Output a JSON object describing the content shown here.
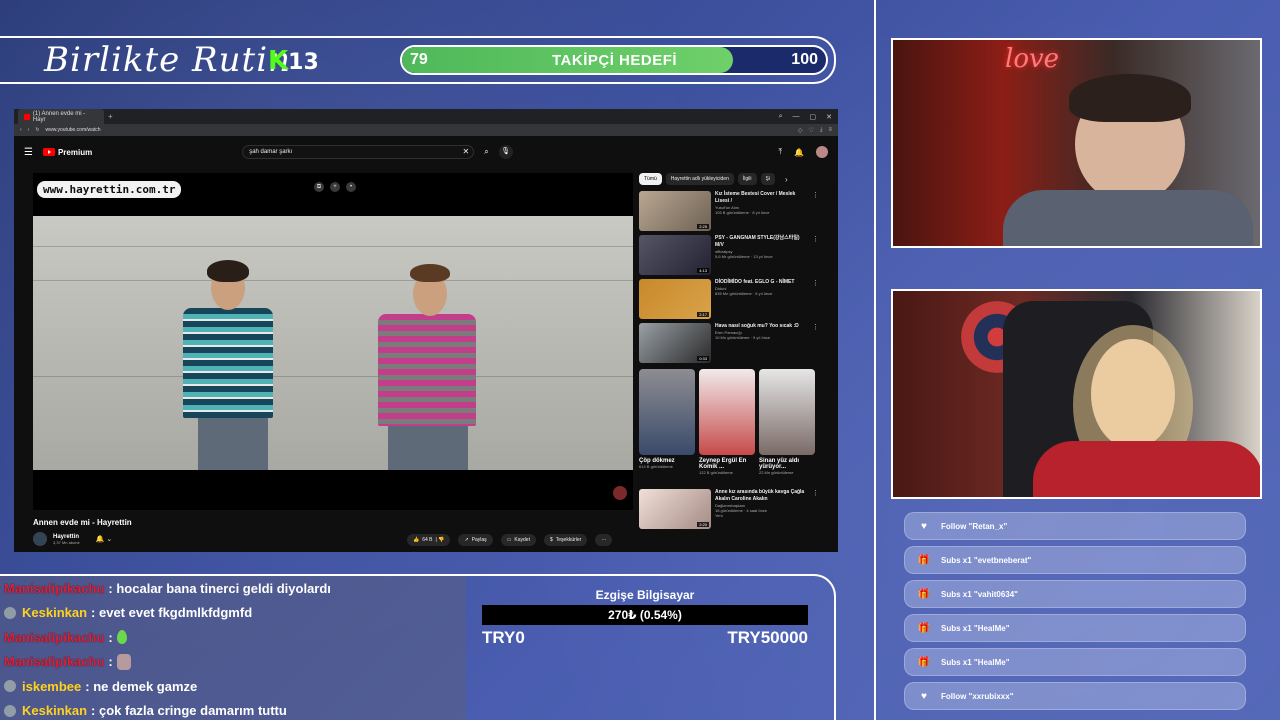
{
  "brand": {
    "title": "Birlikte Rutin",
    "k_letter": "K",
    "k_num": "13"
  },
  "goal": {
    "start": "79",
    "title": "TAKİPÇİ HEDEFİ",
    "end": "100",
    "progress_percent": 79
  },
  "browser": {
    "tab_title": "(1) Annen evde mi - Hayr",
    "url": "www.youtube.com/watch",
    "logo_text": "Premium",
    "search_query": "şah damar şarkı",
    "video_watermark": "www.hayrettin.com.tr",
    "video_title": "Annen evde mi - Hayrettin",
    "channel_name": "Hayrettin",
    "channel_subs": "3,37 Mn abone",
    "actions": {
      "like": "64 B",
      "share": "Paylaş",
      "save": "Kaydet",
      "thanks": "Teşekkürler",
      "more": "···"
    },
    "chips": [
      "Tümü",
      "Hayrettin adlı yükleyiciden",
      "İlgili",
      "Şi"
    ],
    "recommendations": [
      {
        "title": "Kız İsteme Bestesi Cover / Meslek Lisesi /",
        "channel": "Yusuf'un Alını",
        "meta": "105 B görüntüleme · 8 yıl önce",
        "duration": "2:25"
      },
      {
        "title": "PSY - GANGNAM STYLE(강남스타일) M/V",
        "channel": "officialpsy",
        "meta": "5,6 Mr görüntüleme · 13 yıl önce",
        "duration": "4:13"
      },
      {
        "title": "DİODİMİDO feat. EGLO G - NİMET",
        "channel": "Diduni",
        "meta": "835 Mn görüntüleme · 5 yıl önce",
        "duration": "2:17"
      },
      {
        "title": "Hava nasıl soğuk mu? Yoo sıcak :D",
        "channel": "Eren Parnacığı",
        "meta": "10 Mn görüntüleme · 9 yıl önce",
        "duration": "0:33"
      }
    ],
    "shorts": [
      {
        "title": "Çöp dökmez",
        "meta": "614 B görüntüleme"
      },
      {
        "title": "Zeynep Ergül En Komik ...",
        "meta": "122 B görüntüleme"
      },
      {
        "title": "Sinan yüz aldı yürüyor...",
        "meta": "22 Mn görüntüleme"
      }
    ],
    "last_rec": {
      "title": "Anne kız arasında büyük kavga Çağla Akalın Caroline Akalın",
      "channel": "Dağlarımbaşkanı",
      "meta": "18 görüntüleme · 4 saat önce",
      "badge": "Yeni",
      "duration": "2:20"
    }
  },
  "chat": [
    {
      "user": "Manisalipikachu",
      "text": ": hocalar bana tinerci geldi diyolardı",
      "color": "red"
    },
    {
      "user": "Keskinkan",
      "text": ": evet evet fkgdmlkfdgmfd",
      "color": "yellow"
    },
    {
      "user": "Manisalipikachu",
      "text": ":",
      "color": "red",
      "emoji": "drop"
    },
    {
      "user": "Manisalipikachu",
      "text": ":",
      "color": "red",
      "emoji": "girl"
    },
    {
      "user": "iskembee",
      "text": ": ne demek gamze",
      "color": "yellow"
    },
    {
      "user": "Keskinkan",
      "text": ": çok fazla cringe damarım tuttu",
      "color": "yellow"
    }
  ],
  "donation": {
    "name": "Ezgişe Bilgisayar",
    "current": "270₺ (0.54%)",
    "min": "TRY0",
    "max": "TRY50000"
  },
  "alerts": [
    {
      "icon": "heart",
      "text": "Follow \"Retan_x\""
    },
    {
      "icon": "gift",
      "text": "Subs x1 \"evetbneberat\""
    },
    {
      "icon": "gift",
      "text": "Subs x1 \"vahit0634\""
    },
    {
      "icon": "gift",
      "text": "Subs x1 \"HealMe\""
    },
    {
      "icon": "gift",
      "text": "Subs x1 \"HealMe\""
    },
    {
      "icon": "heart",
      "text": "Follow \"xxrubixxx\""
    }
  ],
  "cam_neon": "love"
}
